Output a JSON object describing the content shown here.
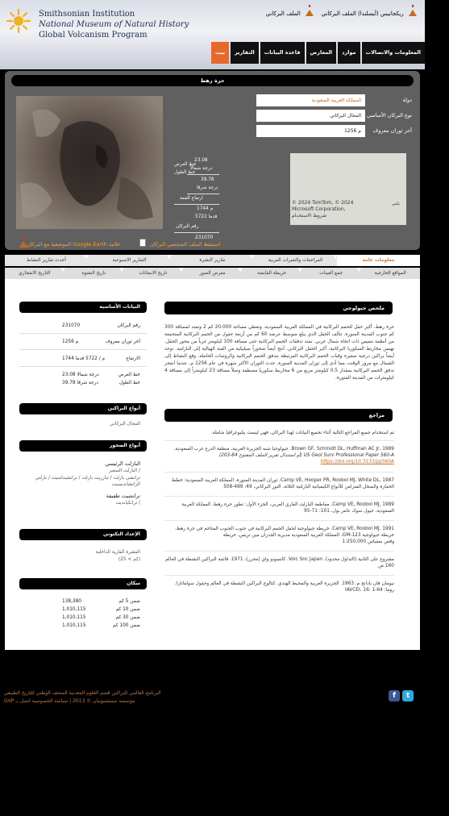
{
  "header": {
    "logo_line1": "Smithsonian Institution",
    "logo_line2": "National Museum of Natural History",
    "logo_line3": "Global Volcanism Program",
    "link_right": "ريكجانيس (أيسلندا) الملف البركاني",
    "link_left": "الملف البركاني"
  },
  "nav": {
    "items": [
      "المعلومات والاتصالات",
      "موارد",
      "المعارض",
      "قاعدة البيانات",
      "التقارير",
      "بيت"
    ],
    "active": "بيت"
  },
  "volcano": {
    "title": "حرة رهط",
    "fields": [
      {
        "label": "دولة",
        "value": "المملكة العربية السعودية"
      },
      {
        "label": "نوع البركان الأساسي",
        "value": "المجال البركاني"
      },
      {
        "label": "آخر ثوران معروف",
        "value": "م 1256"
      }
    ],
    "lat_label": "خط العرض",
    "lat_value": "23.08",
    "lat_unit": "درجة شمالاً",
    "lon_label": "خط الطول",
    "lon_value": "39.78",
    "lon_unit": "درجة شرقا",
    "elev_label": "ارتفاع القمة",
    "elev_m": "1744 م",
    "elev_ft": "5722 قدما",
    "num_label": "رقم البركان",
    "num_value": "231070",
    "map_zoom": "تكبير",
    "map_copy": "© 2024 TomTom, © 2024 Microsoft Corporation, شروط الاستخدام",
    "gearth_link_1": "استيقظ الملف الشخصي البركان",
    "gearth_link_2": "الموضعية مع البركان Google Earth علامة"
  },
  "tabs_row1": [
    "معلومات عامة",
    "المراجعات والتغيرات العربية",
    "تقارير النشرة",
    "التقارير الاسبوعية",
    "أحدث تقارير النشاط"
  ],
  "tabs_row2": [
    "المواقع الخارجية",
    "جمع العينات",
    "خريطة القابضة",
    "معرض الصور",
    "تاريخ الانبعاثات",
    "تاريخ التشوه",
    "التاريخ الانفجاري"
  ],
  "sidebar": {
    "basic_head": "البيانات الأساسية",
    "rows": [
      {
        "label": "رقم البركان",
        "value": "231070"
      },
      {
        "label": "آخر ثوران معروف",
        "value": "م 1256"
      },
      {
        "label": "الارتفاع",
        "value": "م / 5722 قدما 1744"
      },
      {
        "label": "خط العرض",
        "value": "درجة شمالا 23.08"
      },
      {
        "label": "خط الطول",
        "value": "درجة شرقا 39.78"
      }
    ],
    "types_head": "أنواع البراكين",
    "types_text": "المجال البركاني",
    "rock_head": "أنواع الصخور",
    "rock_main": "البازلت الرئيسي",
    "rock_main_2": "البازلت الصغير /",
    "rock_main_3": "ترانشي بازلت / تبارزيت بازلت / ترانشيداسيت / بازلتي الزانشانديسيت",
    "rock_minor": "ترانشيت طفيفة",
    "rock_minor_2": "ترانكيانديت /",
    "tectonic_head": "الإعداد التكتوني",
    "tectonic_text": "القشرة القارية الداخلية",
    "tectonic_text_2": "(25 < كم)",
    "pop_head": "سكان",
    "pop": [
      {
        "label": "ضمن 5 كم",
        "value": "138,380"
      },
      {
        "label": "ضمن 10 كم",
        "value": "1,010,115"
      },
      {
        "label": "ضمن 30 كم",
        "value": "1,010,115"
      },
      {
        "label": "ضمن 100 كم",
        "value": "1,010,115"
      }
    ]
  },
  "summary": {
    "head": "ملخص جيولوجي",
    "text": "حرة رهط، أكبر حقل للحمم البركانية في المملكة العربية السعودية، وتغطي مساحة 20.000 كم 2 وتمتد لمسافة 300 كم جنوب المدينة المنورة. تتألف الحقل الذي يبلغ متوسط عرضه 60 كم من أربعة حقول من الحمم البركانية المتحمعة من أنظمة تنفيس ذات اتجاه شمال غربي. تمتد تدفقات الحمم البركانية حتى مسافة 100 كيلومتر غرباً من محور الحقل. تهيمن مخاريط السكوريا البركانية، أكبر الحقل البركاني. أنتج أيضاً ضحوراً سيليكية من القبة الهيالية إلى البازلتية. توجد أيضاً براكين درجية صغيرة وقباب الحمم البركانية المرتبطة بتدفق الحمم البركانية والروشات الحاملة. وقع النشاط إلى الشمال مع مرور الوقت، مما أدى إلى ثوران المدينة المنورة. حدث الثوران الأكثر شهرة في عام 1256 م، عندما انفجر تدفق الحمم البركانية بمقدار 0.5 كيلومتر مربع من 6 مخاريط سكوريا مصطفة وصلاً مسافة 23 كيلومتراً إلى مسافة 4 كيلومترات من المدينة المنورة."
  },
  "references": {
    "head": "مراجع",
    "intro": "تم استخدام جميع المراجع التالية أثناء تجميع البيانات لهذا البركان، فهي ليست بيليوغرافيا شاملة.",
    "items": [
      {
        "line1": "Brown GF, Schmidt DL, Huffman AC Jr, 1989. جيولوجيا شبه الجزيرة العربية، منطقة الدرع غرب السعودية.",
        "line2": "US Geol Surv Professional Paper 560-A (أو استبدال تقرير الملف المفتوح 84-203)",
        "link": "https://doi.org/10.3133/pp560A"
      },
      {
        "line1": "Camp VE, Hooper PR, Roobol MJ, White DL, 1987. ثوران المدينة المنورة، المملكة العربية السعودية: خطط",
        "line2": "الحفارة والمنخل المتزامن للأنواع الكيميائية البازلتية الثلاثة. النور البركاني، 49: 489-508"
      },
      {
        "line1": "Camp VE, Roobol MJ, 1989. مقاطعة البازلت القاري العربي، الجزء الأول: تطور حرة رهط، المملكة العربية",
        "line2": "السعودية. جيول سوك عامر بول، 101: 71-95"
      },
      {
        "line1": "Camp VE, Roobol MJ, 1991. خريطة جيولوجية لحقل الحمم البركانية في جنوب الجنوب المتاخم في حرة رهط،",
        "line2": "خريطة جيولوجية GM-123، المملكة العربية السعودية مديرية الجدران مين تريس، خريطة",
        "line3": "وقص بمقياس 1:250,000"
      },
      {
        "line1": "مشروع على الثانية (التداول محدود). Volc Soc Japan. كاتسونو واي (محرر)، 1971. قائمة البراكين النشطة في العالم",
        "line2": "160 ص"
      },
      {
        "line1": "نيومان فان بادانج م، 1963. الجزيرة العربية والمحيط الهندي. كتالوج البراكين النشطة في العالم وحقول سولفاتارا،",
        "line2": "روما: IAVCEI، 16: 1-64"
      }
    ]
  },
  "footer": {
    "line1": "البرنامج العالمي للبراكين   قسم العلوم المعدنية   المتحف الوطني للتاريخ الطبيعي",
    "line2": "GVP مؤسسة سميثسونيان © 2013 | سياسة الخصوصية   اتصل بـ"
  },
  "colors": {
    "accent": "#e8672a",
    "link": "#c96a28",
    "fb": "#3b5998",
    "tw": "#2fa7e0"
  }
}
